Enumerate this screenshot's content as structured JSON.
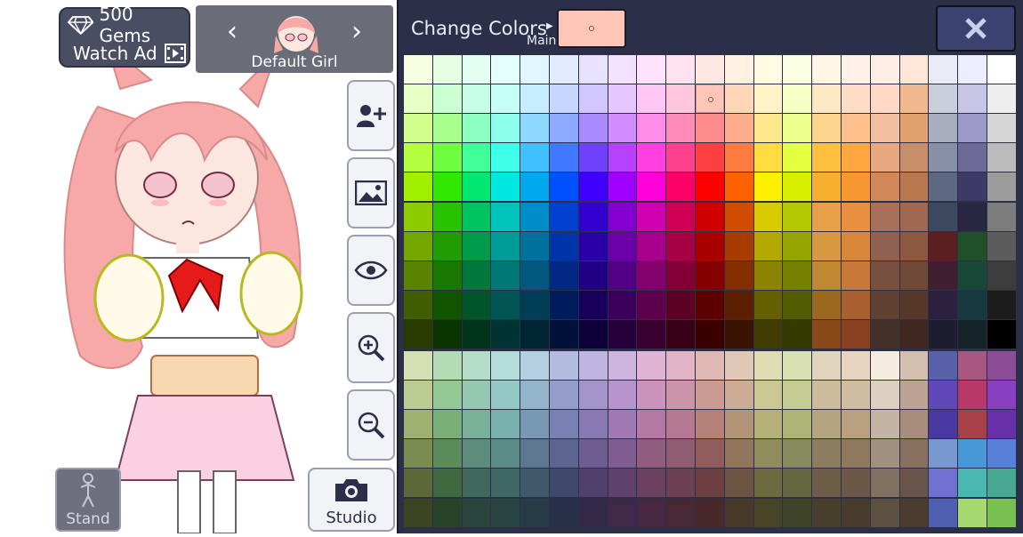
{
  "currency": {
    "gems_label": "500 Gems",
    "watch_ad_label": "Watch Ad"
  },
  "character": {
    "name": "Default Girl",
    "prev_arrow": "‹",
    "next_arrow": "›"
  },
  "side_buttons": [
    {
      "name": "add-character-button",
      "icon": "add-user-icon"
    },
    {
      "name": "background-button",
      "icon": "image-icon"
    },
    {
      "name": "visibility-button",
      "icon": "eye-icon"
    },
    {
      "name": "zoom-in-button",
      "icon": "zoom-in-icon"
    },
    {
      "name": "zoom-out-button",
      "icon": "zoom-out-icon"
    }
  ],
  "bottom_buttons": {
    "stand_label": "Stand",
    "studio_label": "Studio"
  },
  "panel": {
    "title": "Change Colors",
    "main_label": "Main",
    "selected_color": "#ffc5b6",
    "close_label": "X"
  },
  "palette": {
    "rows": [
      [
        "#f6ffe2",
        "#e6ffe2",
        "#e2fff2",
        "#e2fffb",
        "#e2f6ff",
        "#e2ebff",
        "#e8e2ff",
        "#f3e2ff",
        "#ffe2fb",
        "#ffe2ee",
        "#ffe8e2",
        "#fff0e2",
        "#fffbe2",
        "#fbffe2",
        "#fff6e6",
        "#fff0e8",
        "#ffeee6",
        "#ffe6d6",
        "#e9ebf6",
        "#eeecff",
        "#ffffff"
      ],
      [
        "#e8ffc6",
        "#ccffd0",
        "#c6ffe6",
        "#c6fff6",
        "#c6eeff",
        "#c6d6ff",
        "#d2c6ff",
        "#e6c6ff",
        "#ffc6f6",
        "#ffc6dc",
        "#ffc5b6",
        "#ffd6b6",
        "#fff2c6",
        "#f6ffc6",
        "#ffe8c6",
        "#ffdcc6",
        "#ffd8c6",
        "#f2b890",
        "#c9cedb",
        "#c8c6e6",
        "#eeeeee"
      ],
      [
        "#d2ff8c",
        "#a8ff8c",
        "#8cffc0",
        "#8cffec",
        "#8cd8ff",
        "#8caaff",
        "#a88cff",
        "#d28cff",
        "#ff8ce8",
        "#ff8cb8",
        "#ff8c8c",
        "#ffac8c",
        "#ffe88c",
        "#ecff8c",
        "#ffd48c",
        "#ffc08c",
        "#f2c0a0",
        "#e0a070",
        "#a7aec0",
        "#9c98c8",
        "#d6d6d6"
      ],
      [
        "#b4ff40",
        "#70ff40",
        "#40ff98",
        "#40ffe8",
        "#40c0ff",
        "#4078ff",
        "#7040ff",
        "#b840ff",
        "#ff40e0",
        "#ff408c",
        "#ff4040",
        "#ff7c40",
        "#ffdc40",
        "#e4ff40",
        "#ffc040",
        "#ffa840",
        "#e8a880",
        "#c8906a",
        "#8790a8",
        "#6e6a98",
        "#bbbbbb"
      ],
      [
        "#a0f000",
        "#30e800",
        "#00e870",
        "#00e8e0",
        "#00a8f0",
        "#0050ff",
        "#4000ff",
        "#a000ff",
        "#ff00d8",
        "#ff0068",
        "#ff0000",
        "#ff6000",
        "#fff000",
        "#d8f000",
        "#f8b030",
        "#f89830",
        "#d08858",
        "#b87850",
        "#5e6880",
        "#3e3a68",
        "#9c9c9c"
      ],
      [
        "#8ccc00",
        "#28c400",
        "#00c460",
        "#00c4bc",
        "#008cc8",
        "#0040d0",
        "#3400d0",
        "#8400d0",
        "#d000b0",
        "#d00054",
        "#d00000",
        "#d04c00",
        "#d8cc00",
        "#b4c800",
        "#e8a048",
        "#e89040",
        "#a87058",
        "#a06850",
        "#3e4860",
        "#282640",
        "#7c7c7c"
      ],
      [
        "#74a800",
        "#209c00",
        "#009c4c",
        "#009c98",
        "#00709c",
        "#0034a8",
        "#2a00a8",
        "#6a00a8",
        "#a8008c",
        "#a80044",
        "#a80000",
        "#a83c00",
        "#b4a800",
        "#94a400",
        "#d89840",
        "#d88838",
        "#906050",
        "#8c5840",
        "#5c2020",
        "#205028",
        "#5c5c5c"
      ],
      [
        "#5a8400",
        "#187800",
        "#00783c",
        "#007876",
        "#00587c",
        "#002884",
        "#200084",
        "#520084",
        "#84006c",
        "#840034",
        "#840000",
        "#842e00",
        "#8c8400",
        "#748000",
        "#c08830",
        "#c87838",
        "#785040",
        "#704838",
        "#402030",
        "#184838",
        "#3c3c3c"
      ],
      [
        "#405e00",
        "#105400",
        "#00542a",
        "#005454",
        "#003e58",
        "#001c5c",
        "#16005c",
        "#3a005c",
        "#5c004c",
        "#5c0024",
        "#5c0000",
        "#5c2000",
        "#646000",
        "#525c00",
        "#9c6820",
        "#a86030",
        "#604030",
        "#583828",
        "#2c2040",
        "#183840",
        "#1c1c1c"
      ],
      [
        "#283c00",
        "#0a3400",
        "#00341a",
        "#003434",
        "#002636",
        "#00123a",
        "#0e003a",
        "#24003a",
        "#3a0030",
        "#3a0016",
        "#3a0000",
        "#3a1400",
        "#403c00",
        "#343a00",
        "#884818",
        "#884020",
        "#443028",
        "#402820",
        "#1e1c30",
        "#142428",
        "#000000"
      ],
      [
        "#d4e0b4",
        "#b4dcb4",
        "#b4dcc8",
        "#b4dcd8",
        "#b4d0e0",
        "#b4bce0",
        "#c0b4e0",
        "#d0b4e0",
        "#e0b4d4",
        "#e0b4c4",
        "#e0b8b4",
        "#e0c8b4",
        "#e0dcb4",
        "#d8e0b4",
        "#e0d4bc",
        "#e8d4c0",
        "#f4ece0",
        "#d4c0b0",
        "#5860a8",
        "#a85880",
        "#8c4c98"
      ],
      [
        "#bccc90",
        "#94c894",
        "#94c8b0",
        "#94c8c4",
        "#94b4cc",
        "#949ccc",
        "#a494cc",
        "#b894cc",
        "#cc94bc",
        "#cc94a8",
        "#cc9c94",
        "#ccac94",
        "#ccc894",
        "#c4cc94",
        "#ccbc9c",
        "#d0bca0",
        "#dcd0c0",
        "#bca494",
        "#6048b8",
        "#b83868",
        "#8840c0"
      ],
      [
        "#a0b070",
        "#78b078",
        "#78b098",
        "#78b0ac",
        "#7898b4",
        "#7880b4",
        "#8878b4",
        "#a078b4",
        "#b478a4",
        "#b47890",
        "#b48078",
        "#b49478",
        "#b4b078",
        "#acb478",
        "#b4a480",
        "#b8a080",
        "#c4b4a4",
        "#a88c7c",
        "#4838a0",
        "#a84048",
        "#6830a8"
      ],
      [
        "#7c8c50",
        "#5c8c5c",
        "#5c8c7c",
        "#5c8c88",
        "#5c7890",
        "#5c6490",
        "#6c5c90",
        "#805c90",
        "#905c80",
        "#905c70",
        "#905c5c",
        "#90745c",
        "#908c5c",
        "#888c5c",
        "#8c7c60",
        "#907860",
        "#a09080",
        "#887060",
        "#7898d0",
        "#4898d8",
        "#5880d8"
      ],
      [
        "#5c6838",
        "#406840",
        "#40685c",
        "#406864",
        "#40586c",
        "#40486c",
        "#50406c",
        "#60406c",
        "#6c4060",
        "#6c4050",
        "#6c4040",
        "#6c5440",
        "#6c6840",
        "#646840",
        "#6c5c48",
        "#6c5848",
        "#807060",
        "#685448",
        "#7070d0",
        "#48b8b0",
        "#48a890"
      ],
      [
        "#3c4424",
        "#284428",
        "#28443c",
        "#284440",
        "#283c48",
        "#283048",
        "#342848",
        "#402848",
        "#482840",
        "#482834",
        "#482828",
        "#483828",
        "#484428",
        "#404428",
        "#48402c",
        "#483c2c",
        "#5c5040",
        "#4c3c30",
        "#5060b0",
        "#a8d870",
        "#78c050"
      ]
    ]
  }
}
